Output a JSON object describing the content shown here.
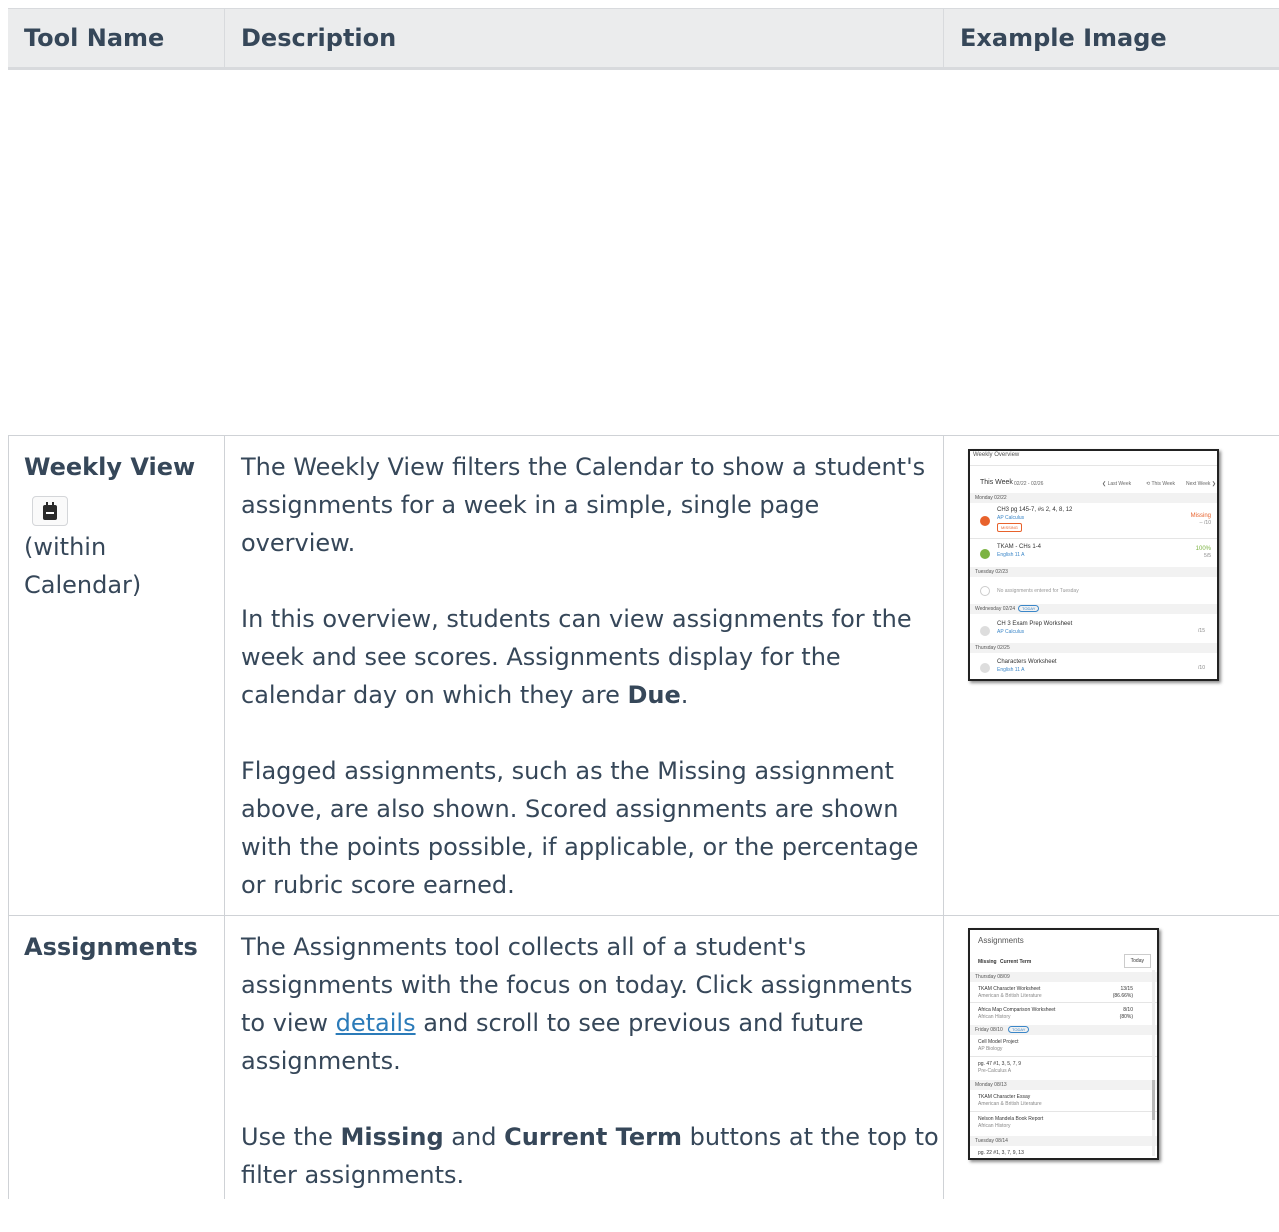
{
  "header": {
    "col1": "Tool Name",
    "col2": "Description",
    "col3": "Example Image"
  },
  "rows": [
    {
      "tool_name": "Weekly View",
      "tool_note_1": "(within",
      "tool_note_2": "Calendar)",
      "icon": "calendar-icon",
      "paragraphs": {
        "p1": "The Weekly View filters the Calendar to show a student's assignments for a week in a simple, single page overview.",
        "p2_before": "In this overview, students can view assignments for the week and see scores. Assignments display for the calendar day on which they are ",
        "p2_bold": "Due",
        "p2_after": ".",
        "p3": "Flagged assignments, such as the Missing assignment above, are also shown. Scored assignments are shown with the points possible, if applicable, or the percentage or rubric score earned."
      },
      "thumbnail": {
        "title": "Weekly Overview",
        "this_week": "This Week",
        "range": "02/22 - 02/26",
        "last_week": "❮ Last Week",
        "this_week_btn": "⟲ This Week",
        "next_week": "Next Week ❯",
        "day1": "Monday 02/22",
        "a1_name": "CH3 pg 145-7, #s 2, 4, 8, 12",
        "a1_course": "AP Calculus",
        "a1_flag": "MISSING",
        "a1_score": "Missing",
        "a1_points": "-- /10",
        "a2_name": "TKAM - CHs 1-4",
        "a2_course": "English 11 A",
        "a2_score": "100%",
        "a2_points": "5/5",
        "day2": "Tuesday 02/23",
        "no_assign": "No assignments entered for Tuesday",
        "day3": "Wednesday 02/24",
        "today": "TODAY",
        "a3_name": "CH 3 Exam Prep Worksheet",
        "a3_course": "AP Calculus",
        "a3_points": "/15",
        "day4": "Thursday 02/25",
        "a4_name": "Characters Worksheet",
        "a4_course": "English 11 A",
        "a4_points": "/10"
      }
    },
    {
      "tool_name": "Assignments",
      "paragraphs": {
        "p1_before": "The Assignments tool collects all of a student's assignments with the focus on today. Click assignments to view ",
        "p1_link": "details",
        "p1_after": " and scroll to see previous and future assignments.",
        "p2_a": "Use the ",
        "p2_b": "Missing",
        "p2_c": " and ",
        "p2_d": "Current Term",
        "p2_e": " buttons at the top to filter assignments."
      },
      "thumbnail": {
        "title": "Assignments",
        "btn_missing": "Missing",
        "btn_term": "Current Term",
        "btn_today": "Today",
        "d1": "Thursday 08/09",
        "i1": "TKAM Character Worksheet",
        "i1s": "American & British Literature",
        "i1score": "13/15",
        "i1pct": "(86.66%)",
        "i2": "Africa Map Comparison Worksheet",
        "i2s": "African History",
        "i2score": "8/10",
        "i2pct": "(80%)",
        "d2": "Friday 08/10",
        "today": "TODAY",
        "i3": "Cell Model Project",
        "i3s": "AP Biology",
        "i4": "pg. 47 #1, 3, 5, 7, 9",
        "i4s": "Pre-Calculus A",
        "d3": "Monday 08/13",
        "i5": "TKAM Character Essay",
        "i5s": "American & British Literature",
        "i6": "Nelson Mandela Book Report",
        "i6s": "African History",
        "d4": "Tuesday 08/14",
        "i7": "pg. 22 #1, 3, 7, 9, 13"
      }
    }
  ],
  "colors": {
    "text": "#364759",
    "link": "#2b7bb9",
    "header_bg": "#ebeced",
    "missing": "#e8622c",
    "success": "#7cb342"
  }
}
